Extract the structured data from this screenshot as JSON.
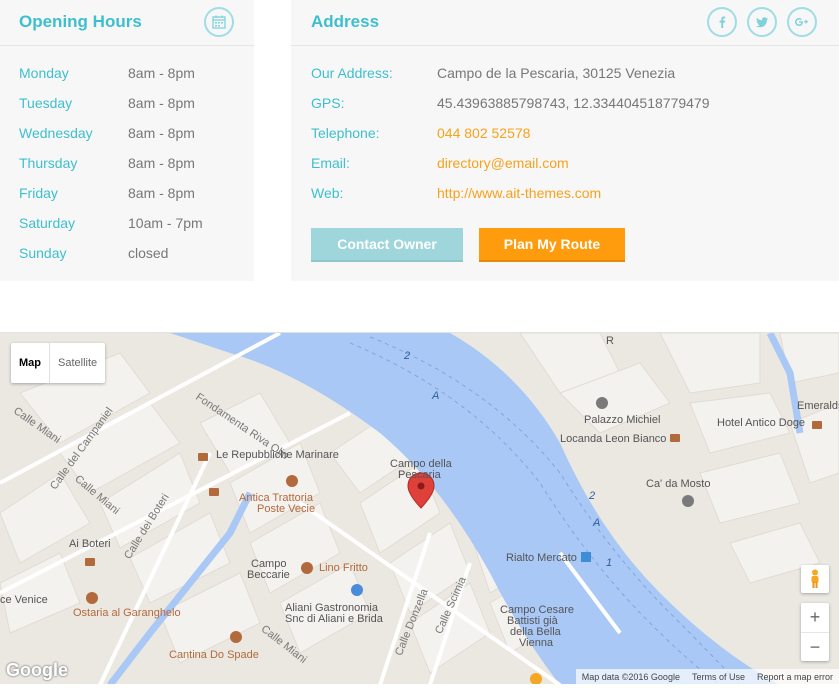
{
  "hours": {
    "title": "Opening Hours",
    "icon": "calendar-icon",
    "days": [
      {
        "day": "Monday",
        "time": "8am - 8pm"
      },
      {
        "day": "Tuesday",
        "time": "8am - 8pm"
      },
      {
        "day": "Wednesday",
        "time": "8am - 8pm"
      },
      {
        "day": "Thursday",
        "time": "8am - 8pm"
      },
      {
        "day": "Friday",
        "time": "8am - 8pm"
      },
      {
        "day": "Saturday",
        "time": "10am - 7pm"
      },
      {
        "day": "Sunday",
        "time": "closed"
      }
    ]
  },
  "address": {
    "title": "Address",
    "social_icons": [
      "facebook-icon",
      "twitter-icon",
      "google-plus-icon"
    ],
    "rows": [
      {
        "label": "Our Address:",
        "value": "Campo de la Pescaria, 30125 Venezia"
      },
      {
        "label": "GPS:",
        "value": "45.43963885798743, 12.334404518779479"
      },
      {
        "label": "Telephone:",
        "value": "044 802 52578"
      },
      {
        "label": "Email:",
        "value": "directory@email.com"
      },
      {
        "label": "Web:",
        "value": "http://www.ait-themes.com"
      }
    ],
    "contact_button": "Contact Owner",
    "route_button": "Plan My Route"
  },
  "colors": {
    "accent": "#3dbfcf",
    "link": "#f7a21b",
    "route_button": "#ff9c0d",
    "contact_button": "#9fd6dc",
    "water": "#a9c8f5"
  },
  "map": {
    "type_map": "Map",
    "type_satellite": "Satellite",
    "zoom_in": "+",
    "zoom_out": "−",
    "logo": "Google",
    "attribution": {
      "data": "Map data ©2016 Google",
      "terms": "Terms of Use",
      "report": "Report a map error"
    },
    "labels": {
      "fondamenta": "Fondamenta Riva Olio",
      "calle_miani_1": "Calle Miani",
      "calle_campaniel": "Calle del Campaniel",
      "calle_miani_2": "Calle Miani",
      "calle_boteri": "Calle dei Boteri",
      "le_repubbliche": "Le Repubbliche Marinare",
      "antica_trattoria": "Antica Trattoria",
      "poste_vecie": "Poste Vecie",
      "campo_pescaria": "Campo della",
      "pescaria": "Pescaria",
      "ai_boteri": "Ai Boteri",
      "campo_beccarie_1": "Campo",
      "campo_beccarie_2": "Beccarie",
      "lino_fritto": "Lino Fritto",
      "aliani_1": "Aliani Gastronomia",
      "aliani_2": "Snc di Aliani e Brida",
      "ce_venice": "ce Venice",
      "ostaria": "Ostaria al Garanghelo",
      "cantina": "Cantina Do Spade",
      "calle_miani_3": "Calle Miani",
      "calle_donzella": "Calle Donzella",
      "calle_scimia": "Calle Scimia",
      "campo_cesare_1": "Campo Cesare",
      "campo_cesare_2": "Battisti già",
      "campo_cesare_3": "della Bella",
      "campo_cesare_4": "Vienna",
      "rialto_mercato": "Rialto Mercato",
      "palazzo_michiel": "Palazzo Michiel",
      "locanda": "Locanda Leon Bianco",
      "ca_da_mosto": "Ca' da Mosto",
      "hotel_antico_doge": "Hotel Antico Doge",
      "emeralds": "Emeralds",
      "ca_right": "Ca",
      "r_letter": "R",
      "lane_2a": "2",
      "lane_a1": "A",
      "lane_2b": "2",
      "lane_a2": "A",
      "lane_1": "1"
    }
  }
}
